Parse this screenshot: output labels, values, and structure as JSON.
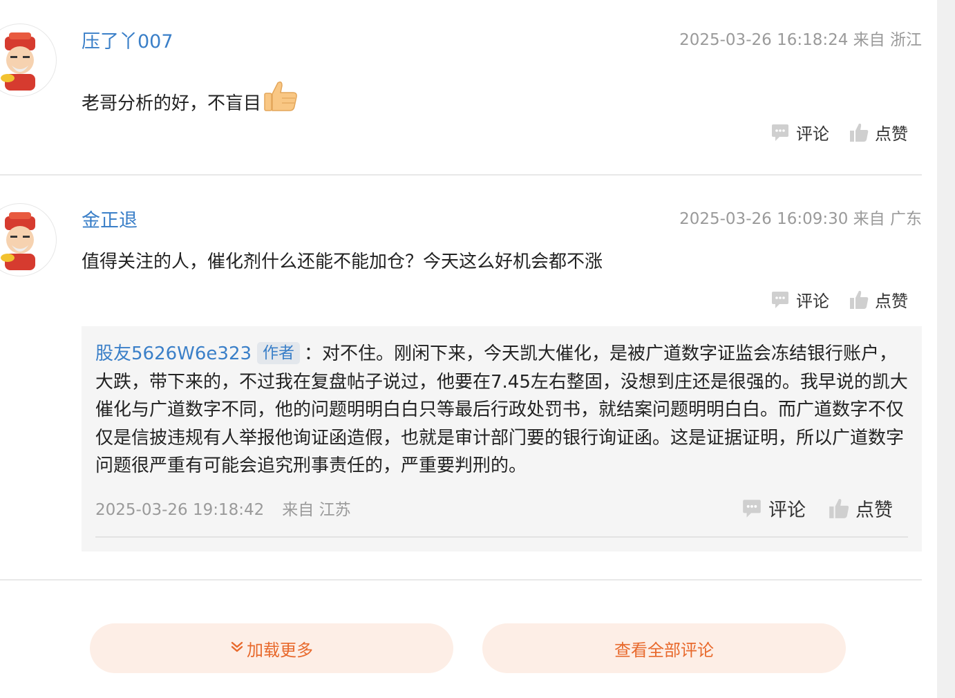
{
  "comments": [
    {
      "username": "压了丫007",
      "timestamp": "2025-03-26 16:18:24 来自 浙江",
      "content": "老哥分析的好，不盲目",
      "emoji": "thumbs-up-emoji",
      "comment_label": "评论",
      "like_label": "点赞"
    },
    {
      "username": "金正退",
      "timestamp": "2025-03-26 16:09:30 来自 广东",
      "content": "值得关注的人，催化剂什么还能不能加仓？今天这么好机会都不涨",
      "comment_label": "评论",
      "like_label": "点赞",
      "reply": {
        "username": "股友5626W6e323",
        "badge": "作者",
        "text": "：对不住。刚闲下来，今天凯大催化，是被广道数字证监会冻结银行账户，大跌，带下来的，不过我在复盘帖子说过，他要在7.45左右整固，没想到庄还是很强的。我早说的凯大催化与广道数字不同，他的问题明明白白只等最后行政处罚书，就结案问题明明白白。而广道数字不仅仅是信披违规有人举报他询证函造假，也就是审计部门要的银行询证函。这是证据证明，所以广道数字问题很严重有可能会追究刑事责任的，严重要判刑的。",
        "timestamp": "2025-03-26 19:18:42",
        "location": "来自 江苏",
        "comment_label": "评论",
        "like_label": "点赞"
      }
    }
  ],
  "buttons": {
    "load_more": "加载更多",
    "view_all": "查看全部评论"
  },
  "colors": {
    "username": "#3a7fc8",
    "accent": "#e8692c",
    "button_bg": "#fdeee6",
    "meta": "#9a9a9a"
  }
}
